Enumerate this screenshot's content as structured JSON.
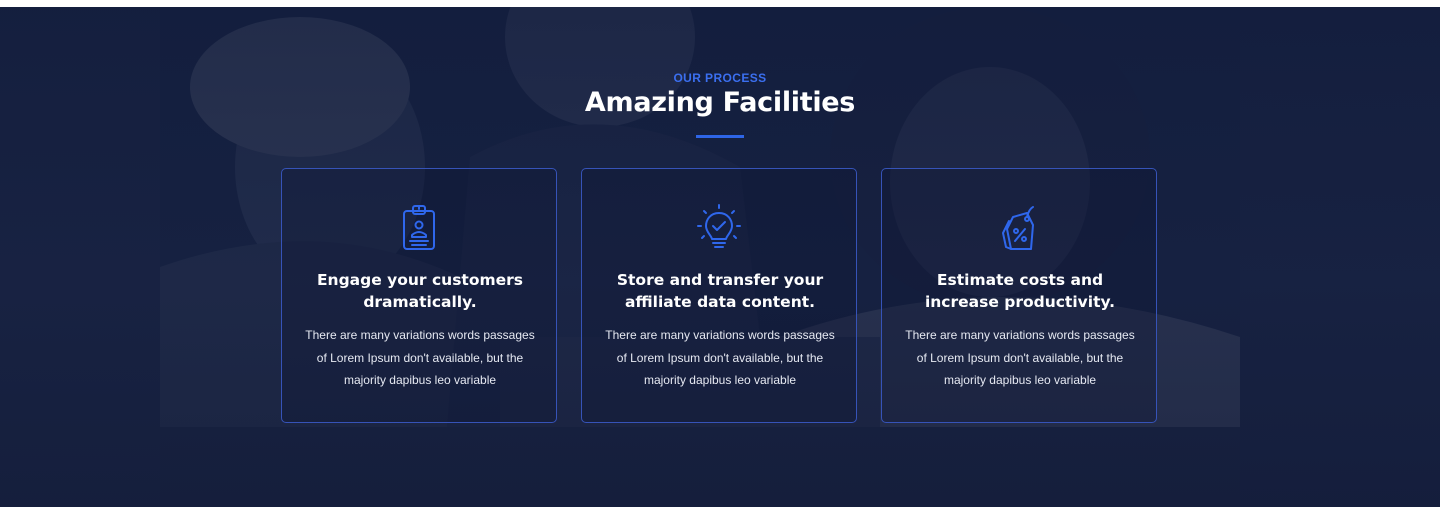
{
  "section": {
    "eyebrow": "OUR PROCESS",
    "title": "Amazing Facilities",
    "accent_color": "#2e65e6"
  },
  "cards": [
    {
      "icon": "id-badge-icon",
      "title": "Engage your customers dramatically.",
      "description": "There are many variations words passages of Lorem Ipsum don't available, but the majority dapibus leo variable"
    },
    {
      "icon": "lightbulb-check-icon",
      "title": "Store and transfer your affiliate data content.",
      "description": "There are many variations words passages of Lorem Ipsum don't available, but the majority dapibus leo variable"
    },
    {
      "icon": "price-tag-percent-icon",
      "title": "Estimate costs and increase productivity.",
      "description": "There are many variations words passages of Lorem Ipsum don't available, but the majority dapibus leo variable"
    }
  ]
}
